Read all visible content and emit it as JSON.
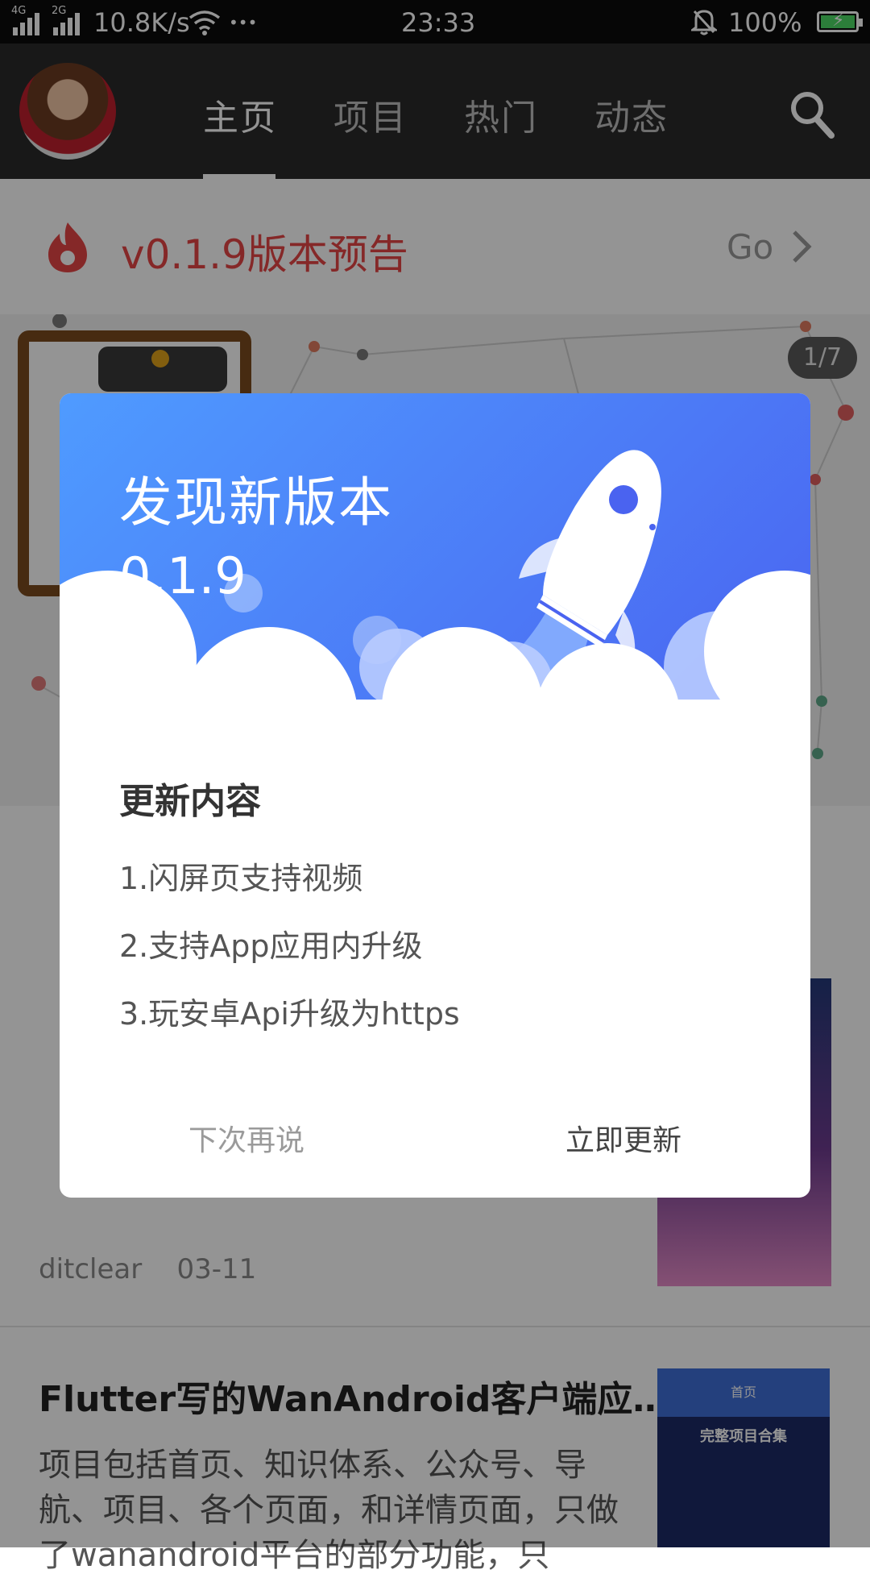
{
  "status_bar": {
    "net1": "4G",
    "net2": "2G",
    "speed": "10.8K/s",
    "dots": "•••",
    "time": "23:33",
    "battery": "100%"
  },
  "header": {
    "tabs": [
      "主页",
      "项目",
      "热门",
      "动态"
    ],
    "active_tab": 0
  },
  "notice": {
    "title": "v0.1.9版本预告",
    "go": "Go"
  },
  "banner": {
    "page_indicator": "1/7"
  },
  "articles": [
    {
      "author": "ditclear",
      "date": "03-11"
    },
    {
      "title": "Flutter写的WanAndroid客户端应…",
      "desc": "项目包括首页、知识体系、公众号、导航、项目、各个页面，和详情页面，只做了wanandroid平台的部分功能，只",
      "thumb_top": "首页",
      "thumb_label": "完整项目合集"
    }
  ],
  "dialog": {
    "title": "发现新版本",
    "version": "0.1.9",
    "section": "更新内容",
    "items": [
      "1.闪屏页支持视频",
      "2.支持App应用内升级",
      "3.玩安卓Api升级为https"
    ],
    "later": "下次再说",
    "update": "立即更新"
  },
  "colors": {
    "accent_red": "#e64545",
    "dialog_blue_start": "#4f9bff",
    "dialog_blue_end": "#4a63f0",
    "header_bg": "#2a2a2a"
  }
}
